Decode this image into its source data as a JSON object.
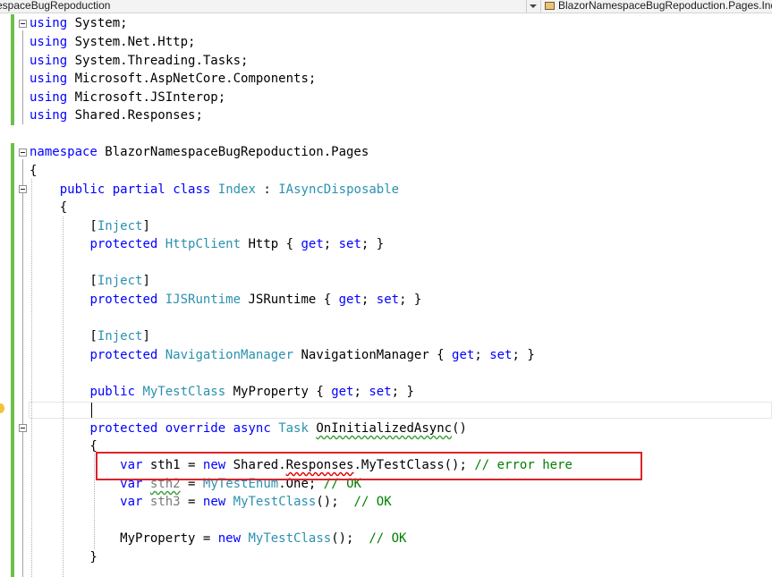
{
  "nav": {
    "left_text": "espaceBugRepoduction",
    "right_text": "BlazorNamespaceBugRepoduction.Pages.Index"
  },
  "code": {
    "l1": {
      "kw": "using",
      "rest": " System;"
    },
    "l2": {
      "kw": "using",
      "rest": " System.Net.Http;"
    },
    "l3": {
      "kw": "using",
      "rest": " System.Threading.Tasks;"
    },
    "l4": {
      "kw": "using",
      "rest": " Microsoft.AspNetCore.Components;"
    },
    "l5": {
      "kw": "using",
      "rest": " Microsoft.JSInterop;"
    },
    "l6": {
      "kw": "using",
      "rest": " Shared.Responses;"
    },
    "ns": {
      "kw": "namespace",
      "rest": " BlazorNamespaceBugRepoduction.Pages"
    },
    "brace_open": "{",
    "class_decl": {
      "indent": "    ",
      "kw1": "public",
      "kw2": "partial",
      "kw3": "class",
      "name": "Index",
      "colon": " : ",
      "iface": "IAsyncDisposable"
    },
    "class_brace": "    {",
    "inject1": {
      "indent": "        [",
      "attr": "Inject",
      "close": "]"
    },
    "http": {
      "indent": "        ",
      "kw": "protected",
      "type": "HttpClient",
      "name": " Http { ",
      "get": "get",
      "sep": "; ",
      "set": "set",
      "end": "; }"
    },
    "inject2": {
      "indent": "        [",
      "attr": "Inject",
      "close": "]"
    },
    "js": {
      "indent": "        ",
      "kw": "protected",
      "type": "IJSRuntime",
      "name": " JSRuntime { ",
      "get": "get",
      "sep": "; ",
      "set": "set",
      "end": "; }"
    },
    "inject3": {
      "indent": "        [",
      "attr": "Inject",
      "close": "]"
    },
    "nav": {
      "indent": "        ",
      "kw": "protected",
      "type": "NavigationManager",
      "name": " NavigationManager { ",
      "get": "get",
      "sep": "; ",
      "set": "set",
      "end": "; }"
    },
    "prop": {
      "indent": "        ",
      "kw": "public",
      "type": "MyTestClass",
      "name": " MyProperty { ",
      "get": "get",
      "sep": "; ",
      "set": "set",
      "end": "; }"
    },
    "method": {
      "indent": "        ",
      "kw1": "protected",
      "kw2": "override",
      "kw3": "async",
      "type": "Task",
      "name": "OnInitializedAsync",
      "end": "()"
    },
    "method_brace": "        {",
    "sth1": {
      "indent": "            ",
      "kw": "var",
      "name": " sth1 = ",
      "new": "new",
      "p1": " Shared.",
      "p2": "Responses",
      "p3": ".MyTestClass(); ",
      "comment": "// error here"
    },
    "sth2": {
      "indent": "            ",
      "kw": "var",
      "sp": " ",
      "name": "sth2",
      "eq": " = ",
      "type": "MyTestEnum",
      "rest": ".One; ",
      "comment": "// OK"
    },
    "sth3": {
      "indent": "            ",
      "kw": "var",
      "sp": " ",
      "name": "sth3",
      "eq": " = ",
      "new": "new",
      "sp2": " ",
      "type": "MyTestClass",
      "rest": "();  ",
      "comment": "// OK"
    },
    "assign": {
      "indent": "            ",
      "name": "MyProperty = ",
      "new": "new",
      "sp": " ",
      "type": "MyTestClass",
      "rest": "();  ",
      "comment": "// OK"
    },
    "method_close": "        }"
  },
  "colors": {
    "keyword": "#0000ff",
    "type": "#2b91af",
    "comment": "#008000",
    "highlight_box": "#d9242a",
    "change_bar": "#6cc04a"
  }
}
